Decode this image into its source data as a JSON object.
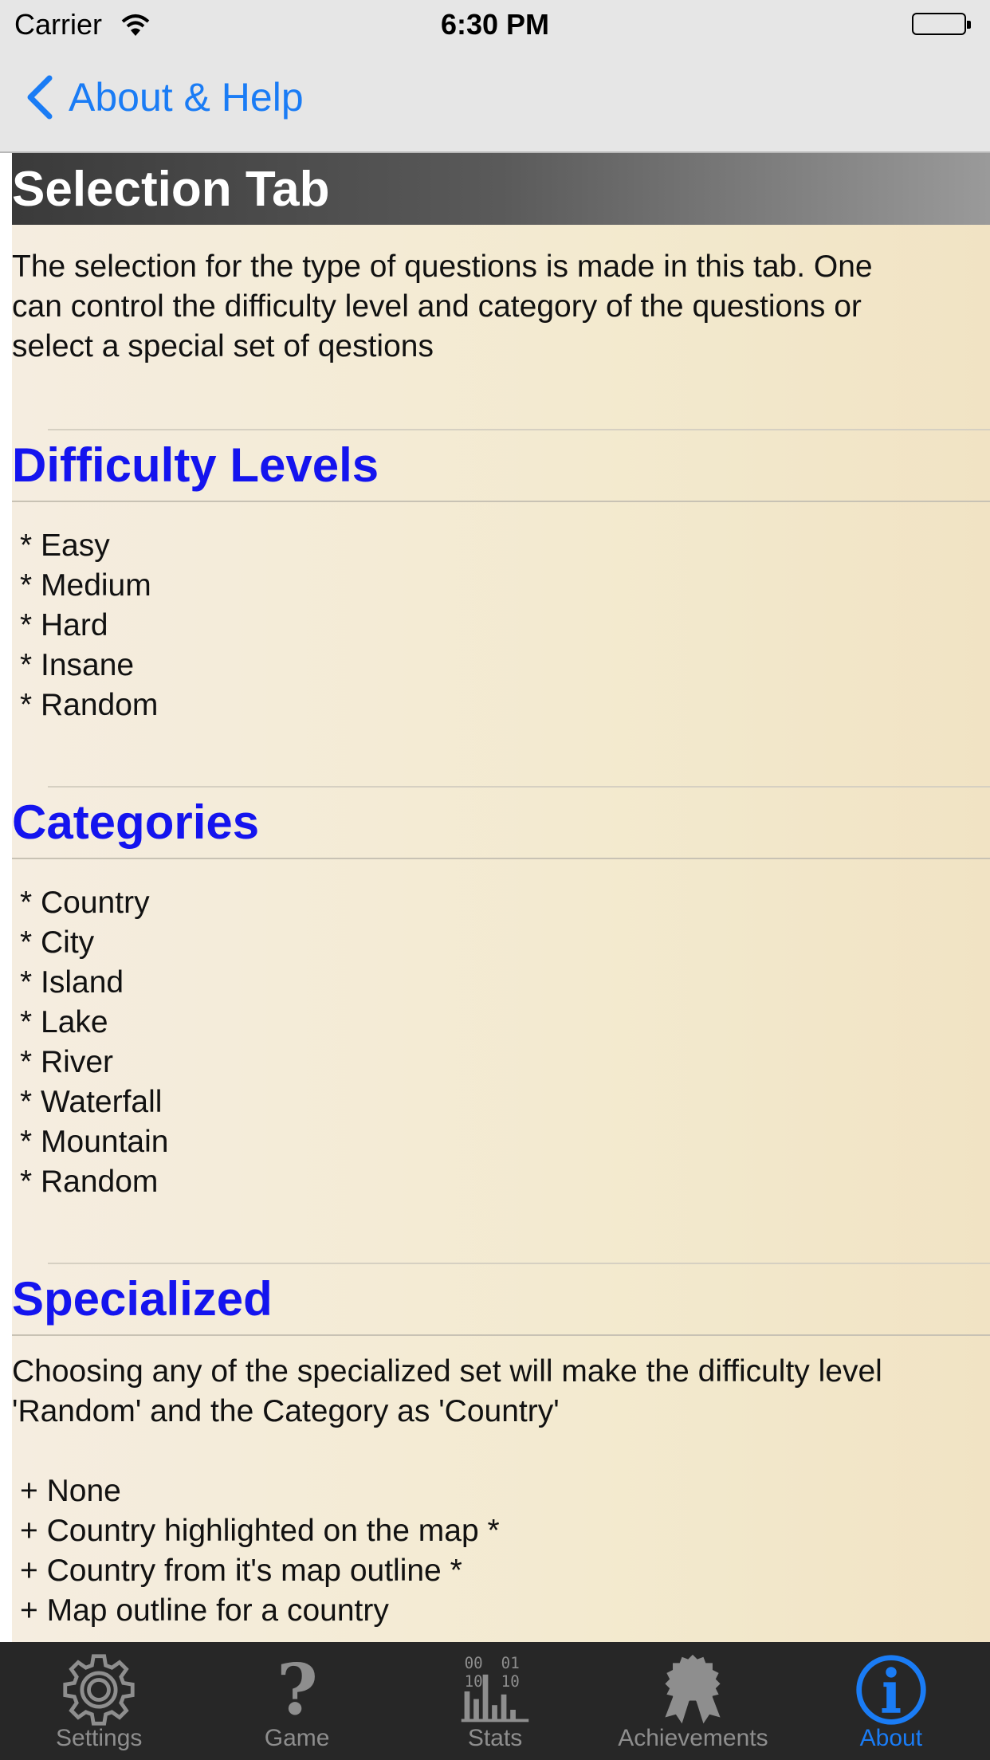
{
  "status_bar": {
    "carrier": "Carrier",
    "time": "6:30 PM"
  },
  "nav": {
    "back_label": "About & Help"
  },
  "content": {
    "title": "Selection Tab",
    "intro_lines": [
      "The selection for the type of questions is made in this tab. One",
      "can control the difficulty level and category of the questions or",
      "select a special set of qestions"
    ],
    "difficulty": {
      "heading": "Difficulty Levels",
      "items": [
        "* Easy",
        "* Medium",
        "* Hard",
        "* Insane",
        "* Random"
      ]
    },
    "categories": {
      "heading": "Categories",
      "items": [
        "* Country",
        "* City",
        "* Island",
        "* Lake",
        "* River",
        "* Waterfall",
        "* Mountain",
        "* Random"
      ]
    },
    "specialized": {
      "heading": "Specialized",
      "desc_lines": [
        "Choosing any of the specialized set will make the difficulty level",
        "'Random' and the Category as 'Country'"
      ],
      "items": [
        "+ None",
        "+ Country highlighted on the map *",
        "+ Country from it's map outline *",
        "+ Map outline for a country"
      ]
    }
  },
  "tabs": [
    {
      "label": "Settings",
      "icon": "gear-icon"
    },
    {
      "label": "Game",
      "icon": "question-mark-icon"
    },
    {
      "label": "Stats",
      "icon": "stats-chart-icon"
    },
    {
      "label": "Achievements",
      "icon": "ribbon-award-icon"
    },
    {
      "label": "About",
      "icon": "info-circle-icon",
      "active": true
    }
  ],
  "colors": {
    "accent": "#1a7cf5",
    "heading": "#1414ee",
    "tab_bar": "#272727",
    "content_bg": "#f3eacf"
  }
}
